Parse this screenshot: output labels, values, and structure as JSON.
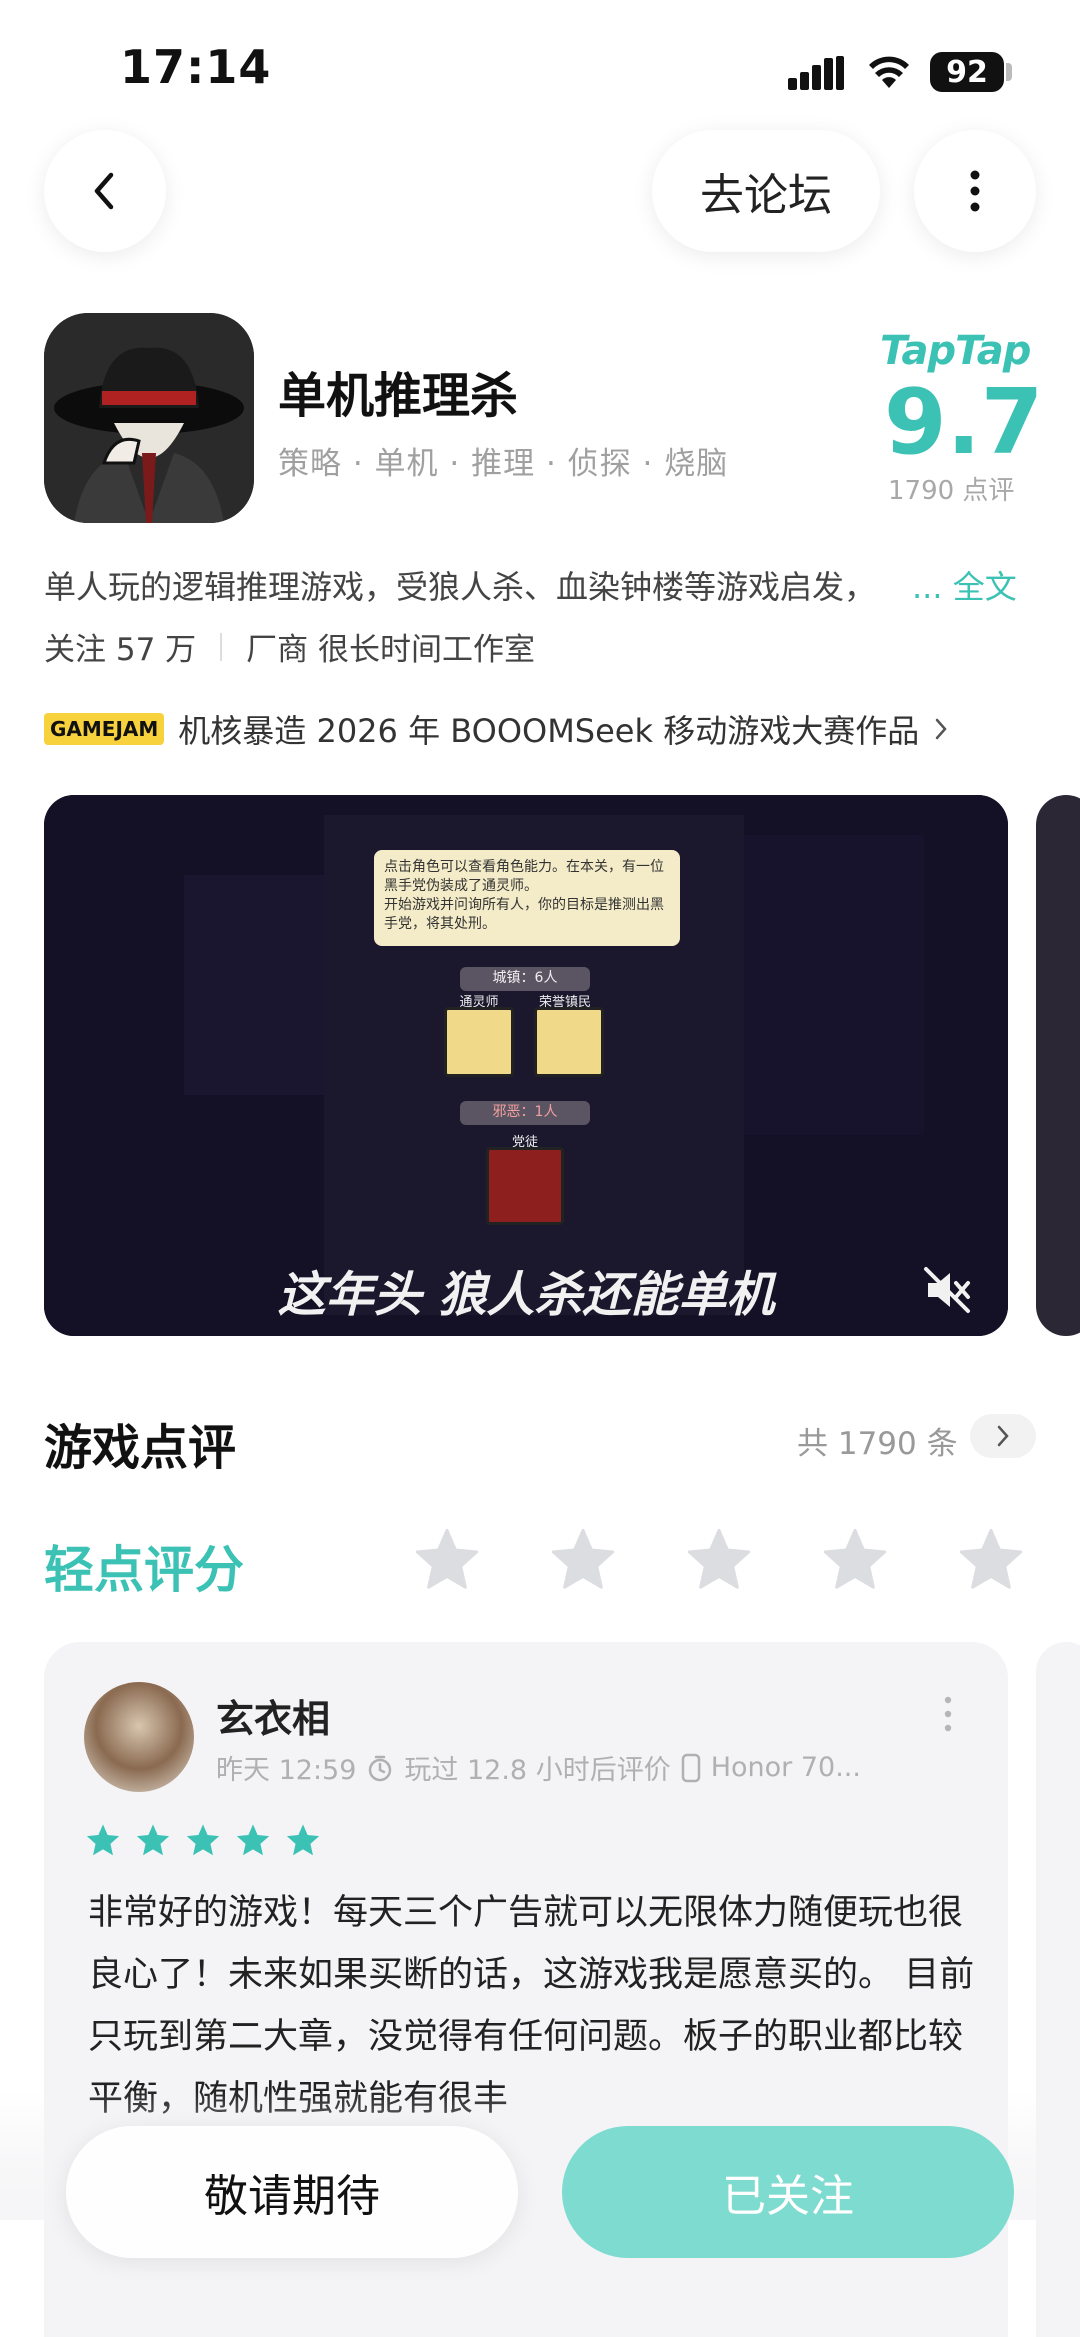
{
  "status": {
    "time": "17:14",
    "battery": "92"
  },
  "nav": {
    "forum_label": "去论坛"
  },
  "app": {
    "title": "单机推理杀",
    "tags": "策略 · 单机 · 推理 · 侦探 · 烧脑",
    "taptap_logo": "TapTap",
    "score": "9.7",
    "score_count": "1790 点评",
    "description": "单人玩的逻辑推理游戏，受狼人杀、血染钟楼等游戏启发，",
    "more_label": "... 全文",
    "followers": "关注 57 万",
    "vendor": "厂商 很长时间工作室",
    "jam_badge": "GAMEJAM",
    "jam_text": "机核暴造 2026 年 BOOOMSeek 移动游戏大赛作品"
  },
  "video": {
    "dialog_line1": "点击角色可以查看角色能力。在本关，有一位黑手党伪装成了通灵师。",
    "dialog_line2": "开始游戏并问询所有人，你的目标是推测出黑手党，将其处刑。",
    "town_count": "城镇：6人",
    "role1": "通灵师",
    "role2": "荣誉镇民",
    "evil_count": "邪恶：1人",
    "role3": "党徒",
    "caption": "这年头 狼人杀还能单机"
  },
  "reviews": {
    "section_title": "游戏点评",
    "total": "共 1790 条",
    "rate_label": "轻点评分",
    "card": {
      "name": "玄衣相",
      "time": "昨天 12:59",
      "playtime": "玩过 12.8 小时后评价",
      "device": "Honor 70...",
      "stars": 5,
      "text": "非常好的游戏！每天三个广告就可以无限体力随便玩也很良心了！未来如果买断的话，这游戏我是愿意买的。 目前只玩到第二大章，没觉得有任何问题。板子的职业都比较平衡，随机性强就能有很丰"
    }
  },
  "actions": {
    "wait_label": "敬请期待",
    "follow_label": "已关注"
  },
  "colors": {
    "accent": "#3cc2b5",
    "follow_button": "#7edbcf",
    "jam_badge": "#f7d23c"
  }
}
